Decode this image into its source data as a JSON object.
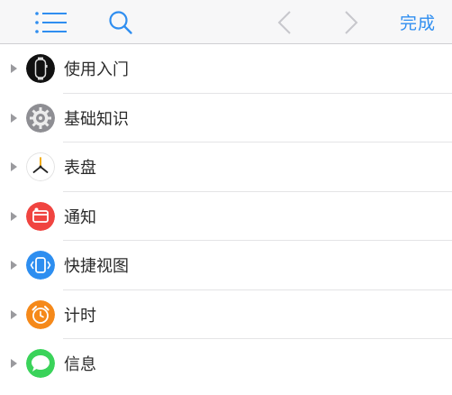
{
  "toolbar": {
    "list_icon": "list-icon",
    "search_icon": "search-icon",
    "back_icon": "chevron-left-icon",
    "forward_icon": "chevron-right-icon",
    "done_label": "完成",
    "accent_color": "#2f8ef0",
    "disabled_color": "#c7c7cc"
  },
  "sections": [
    {
      "label": "使用入门",
      "icon": "watch-icon"
    },
    {
      "label": "基础知识",
      "icon": "settings-gear-icon"
    },
    {
      "label": "表盘",
      "icon": "clock-face-icon"
    },
    {
      "label": "通知",
      "icon": "notification-icon"
    },
    {
      "label": "快捷视图",
      "icon": "glances-icon"
    },
    {
      "label": "计时",
      "icon": "alarm-clock-icon"
    },
    {
      "label": "信息",
      "icon": "messages-icon"
    }
  ]
}
